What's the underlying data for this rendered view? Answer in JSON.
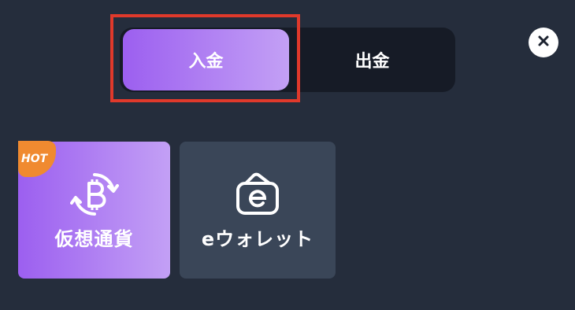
{
  "tabs": {
    "deposit_label": "入金",
    "withdraw_label": "出金",
    "active": "deposit"
  },
  "close": {
    "icon": "close-icon"
  },
  "methods": [
    {
      "label": "仮想通貨",
      "icon": "bitcoin-exchange-icon",
      "badge": "HOT"
    },
    {
      "label": "eウォレット",
      "icon": "e-wallet-icon"
    }
  ],
  "colors": {
    "background": "#252d3c",
    "tab_track": "#161b26",
    "accent_start": "#9c5ff0",
    "accent_end": "#c3a0f5",
    "card_secondary": "#3a4658",
    "highlight": "#e0392b",
    "badge": "#f08a30"
  }
}
